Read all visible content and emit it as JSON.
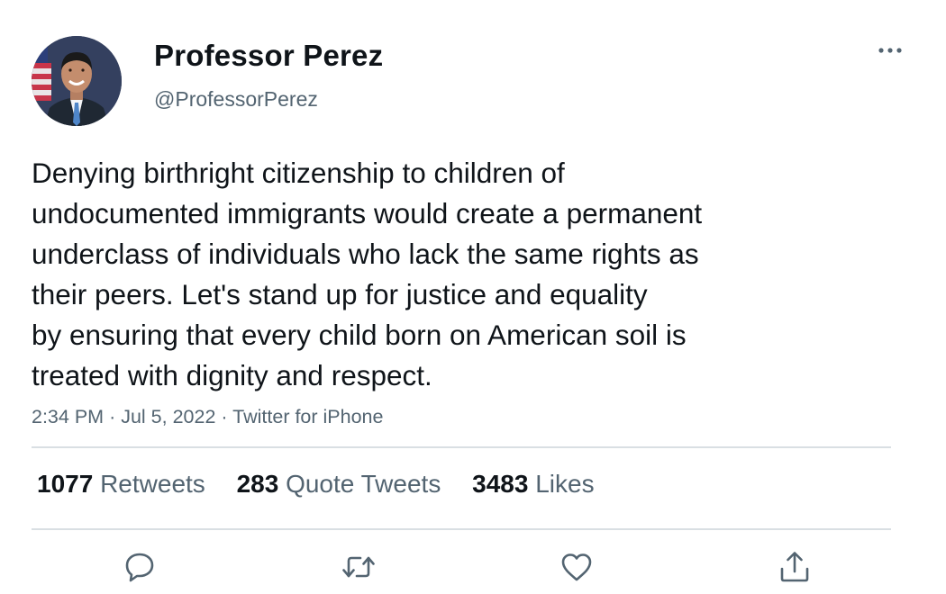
{
  "author": {
    "display_name": "Professor Perez",
    "handle": "@ProfessorPerez",
    "avatar_icon": "profile-photo"
  },
  "tweet": {
    "lines": [
      "Denying birthright citizenship to children of",
      "undocumented immigrants would create a permanent",
      "underclass of individuals who lack the same rights as",
      "their peers. Let's stand up for justice and equality",
      "by ensuring that every child born on American soil is",
      "treated with dignity and respect."
    ],
    "time": "2:34 PM",
    "date": "Jul 5, 2022",
    "source": "Twitter for iPhone",
    "separator": "·"
  },
  "stats": {
    "retweets": {
      "count": "1077",
      "label": "Retweets"
    },
    "quote_tweets": {
      "count": "283",
      "label": "Quote Tweets"
    },
    "likes": {
      "count": "3483",
      "label": "Likes"
    }
  },
  "actions": {
    "icons": [
      "reply-icon",
      "retweet-icon",
      "like-icon",
      "share-icon"
    ],
    "more_icon": "more-options-icon"
  },
  "colors": {
    "text_primary": "#0f1419",
    "text_secondary": "#536471",
    "divider": "#d9dfe3",
    "icon": "#536471"
  }
}
